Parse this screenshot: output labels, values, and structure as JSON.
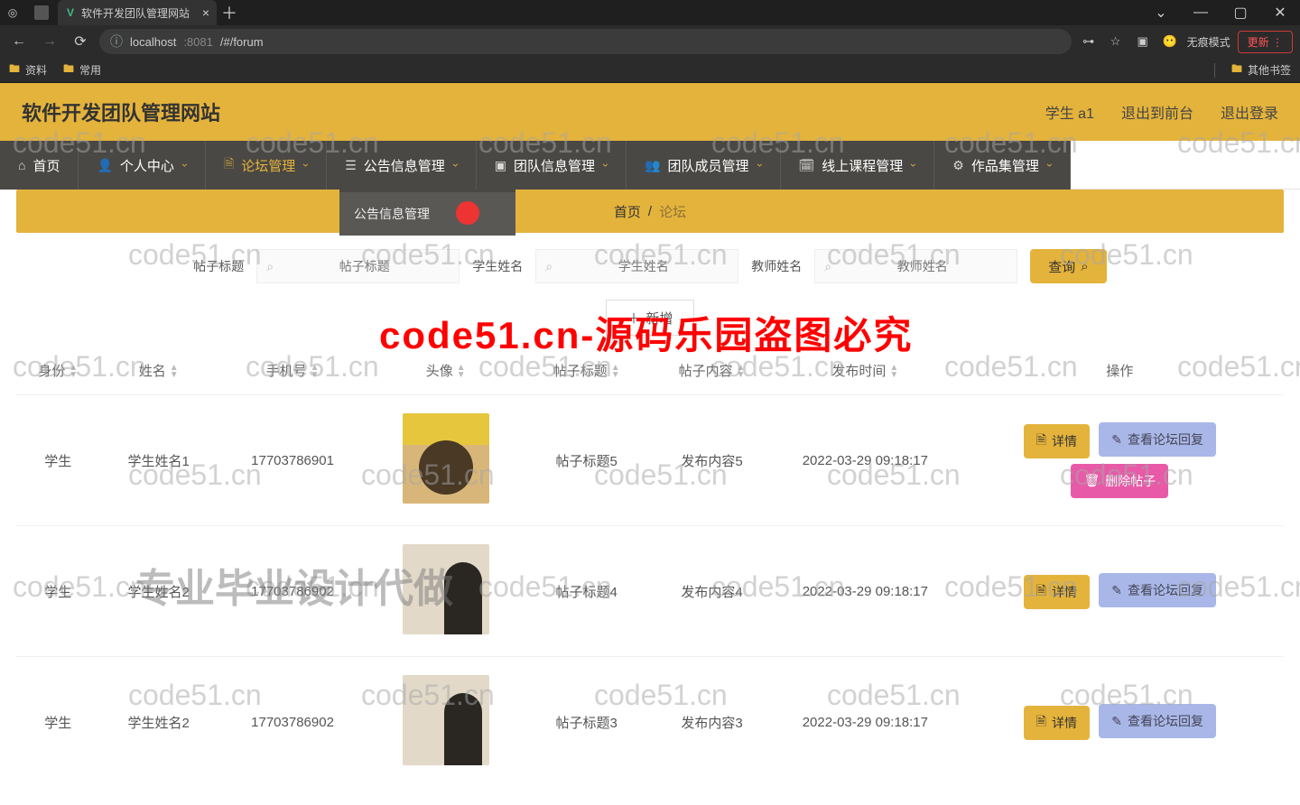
{
  "browser": {
    "tab_title": "软件开发团队管理网站",
    "url_host": "localhost",
    "url_port": ":8081",
    "url_path": "/#/forum",
    "update_btn": "更新",
    "incognito": "无痕模式",
    "bookmarks": {
      "b1": "资料",
      "b2": "常用",
      "other": "其他书签"
    }
  },
  "header": {
    "site_title": "软件开发团队管理网站",
    "user_label": "学生 a1",
    "link_front": "退出到前台",
    "link_logout": "退出登录"
  },
  "nav": {
    "items": [
      {
        "label": "首页",
        "dropdown": false
      },
      {
        "label": "个人中心",
        "dropdown": true
      },
      {
        "label": "论坛管理",
        "dropdown": true,
        "active": true
      },
      {
        "label": "公告信息管理",
        "dropdown": true
      },
      {
        "label": "团队信息管理",
        "dropdown": true
      },
      {
        "label": "团队成员管理",
        "dropdown": true
      },
      {
        "label": "线上课程管理",
        "dropdown": true
      },
      {
        "label": "作品集管理",
        "dropdown": true
      }
    ],
    "dropdown_under": {
      "label": "公告信息管理"
    }
  },
  "breadcrumb": {
    "root": "首页",
    "current": "论坛"
  },
  "filters": {
    "f1_label": "帖子标题",
    "f1_placeholder": "帖子标题",
    "f2_label": "学生姓名",
    "f2_placeholder": "学生姓名",
    "f3_label": "教师姓名",
    "f3_placeholder": "教师姓名",
    "search_btn": "查询"
  },
  "add_btn": "新增",
  "columns": {
    "c0": "身份",
    "c1": "姓名",
    "c2": "手机号",
    "c3": "头像",
    "c4": "帖子标题",
    "c5": "帖子内容",
    "c6": "发布时间",
    "c7": "操作"
  },
  "actions": {
    "detail": "详情",
    "reply": "查看论坛回复",
    "del": "删除帖子"
  },
  "rows": [
    {
      "role": "学生",
      "name": "学生姓名1",
      "phone": "17703786901",
      "title": "帖子标题5",
      "content": "发布内容5",
      "time": "2022-03-29 09:18:17",
      "avatar": "yellow",
      "show_del": true
    },
    {
      "role": "学生",
      "name": "学生姓名2",
      "phone": "17703786902",
      "title": "帖子标题4",
      "content": "发布内容4",
      "time": "2022-03-29 09:18:17",
      "avatar": "person",
      "show_del": false
    },
    {
      "role": "学生",
      "name": "学生姓名2",
      "phone": "17703786902",
      "title": "帖子标题3",
      "content": "发布内容3",
      "time": "2022-03-29 09:18:17",
      "avatar": "person",
      "show_del": false
    }
  ],
  "watermark": {
    "text": "code51.cn",
    "red": "code51.cn-源码乐园盗图必究",
    "big": "专业毕业设计代做"
  }
}
